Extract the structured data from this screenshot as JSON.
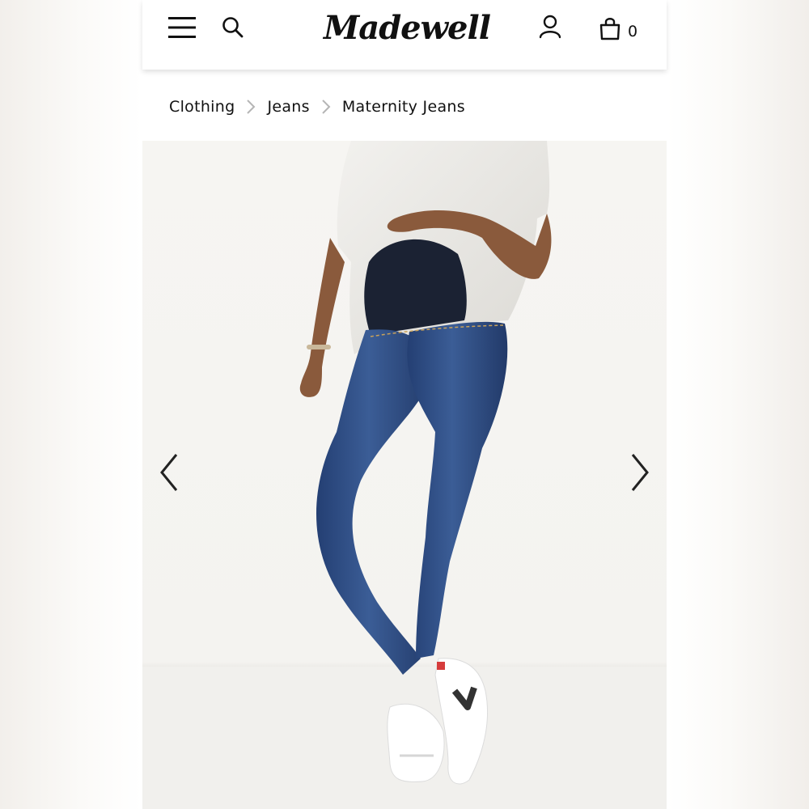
{
  "brand": {
    "logo_text": "Madewell"
  },
  "header": {
    "menu_icon": "hamburger-menu-icon",
    "search_icon": "search-icon",
    "account_icon": "user-account-icon",
    "bag_icon": "shopping-bag-icon",
    "bag_count": "0"
  },
  "breadcrumb": {
    "items": [
      "Clothing",
      "Jeans",
      "Maternity Jeans"
    ],
    "separator_icon": "chevron-right-icon"
  },
  "gallery": {
    "image_alt": "Model wearing maternity skinny jeans with white shirt and white sneakers",
    "prev_icon": "chevron-left-icon",
    "next_icon": "chevron-right-icon"
  },
  "colors": {
    "text": "#111111",
    "separator": "#b5b5b5",
    "denim": "#2f4f86",
    "image_bg": "#f5f4f1"
  }
}
